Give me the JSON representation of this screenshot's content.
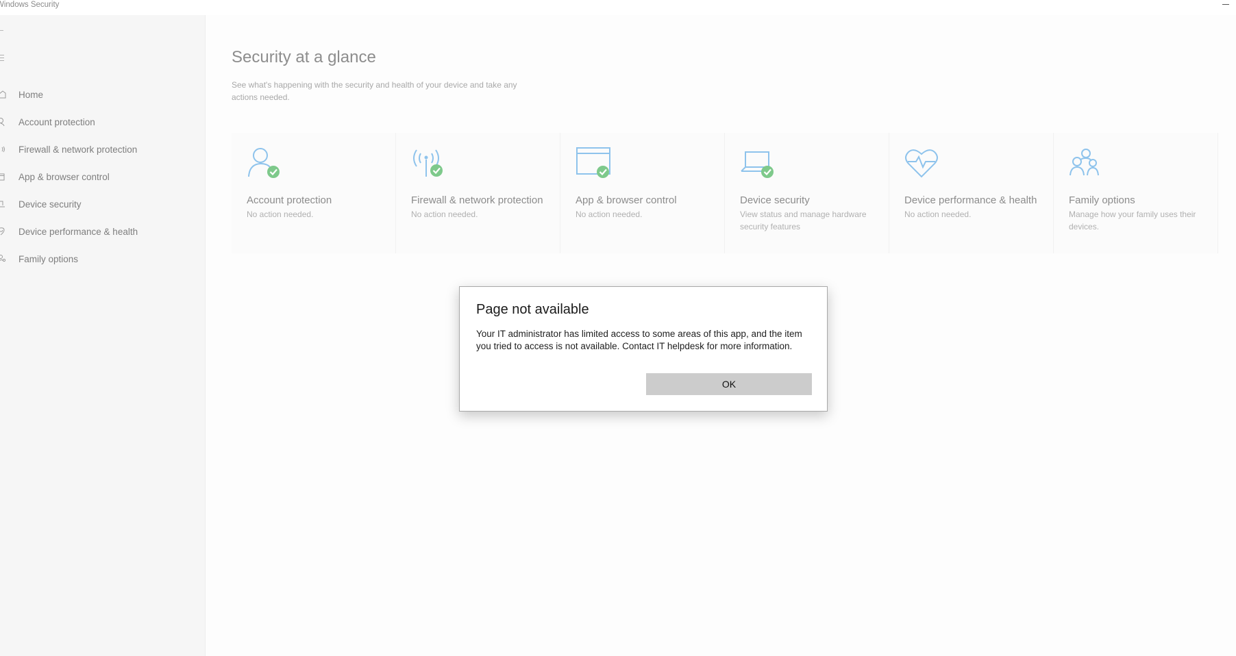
{
  "window": {
    "title": "Windows Security"
  },
  "sidebar": {
    "items": [
      {
        "label": "Home",
        "icon": "home-icon"
      },
      {
        "label": "Account protection",
        "icon": "person-icon"
      },
      {
        "label": "Firewall & network protection",
        "icon": "wifi-signal-icon"
      },
      {
        "label": "App & browser control",
        "icon": "browser-window-icon"
      },
      {
        "label": "Device security",
        "icon": "laptop-icon"
      },
      {
        "label": "Device performance & health",
        "icon": "heart-icon"
      },
      {
        "label": "Family options",
        "icon": "family-icon"
      }
    ]
  },
  "main": {
    "title": "Security at a glance",
    "subtitle": "See what's happening with the security and health of your device and take any actions needed.",
    "tiles": [
      {
        "title": "Account protection",
        "status": "No action needed.",
        "icon": "person-check-icon"
      },
      {
        "title": "Firewall & network protection",
        "status": "No action needed.",
        "icon": "antenna-check-icon"
      },
      {
        "title": "App & browser control",
        "status": "No action needed.",
        "icon": "browser-window-check-icon"
      },
      {
        "title": "Device security",
        "status": "View status and manage hardware security features",
        "icon": "laptop-check-icon"
      },
      {
        "title": "Device performance & health",
        "status": "No action needed.",
        "icon": "heart-pulse-icon"
      },
      {
        "title": "Family options",
        "status": "Manage how your family uses their devices.",
        "icon": "family-icon"
      }
    ]
  },
  "dialog": {
    "title": "Page not available",
    "message": "Your IT administrator has limited access to some areas of this app, and the item you tried to access is not available. Contact IT helpdesk for more information.",
    "ok_label": "OK"
  },
  "colors": {
    "icon_blue": "#8ec3ec",
    "check_green": "#7ec98b",
    "dialog_button": "#cccccc"
  }
}
